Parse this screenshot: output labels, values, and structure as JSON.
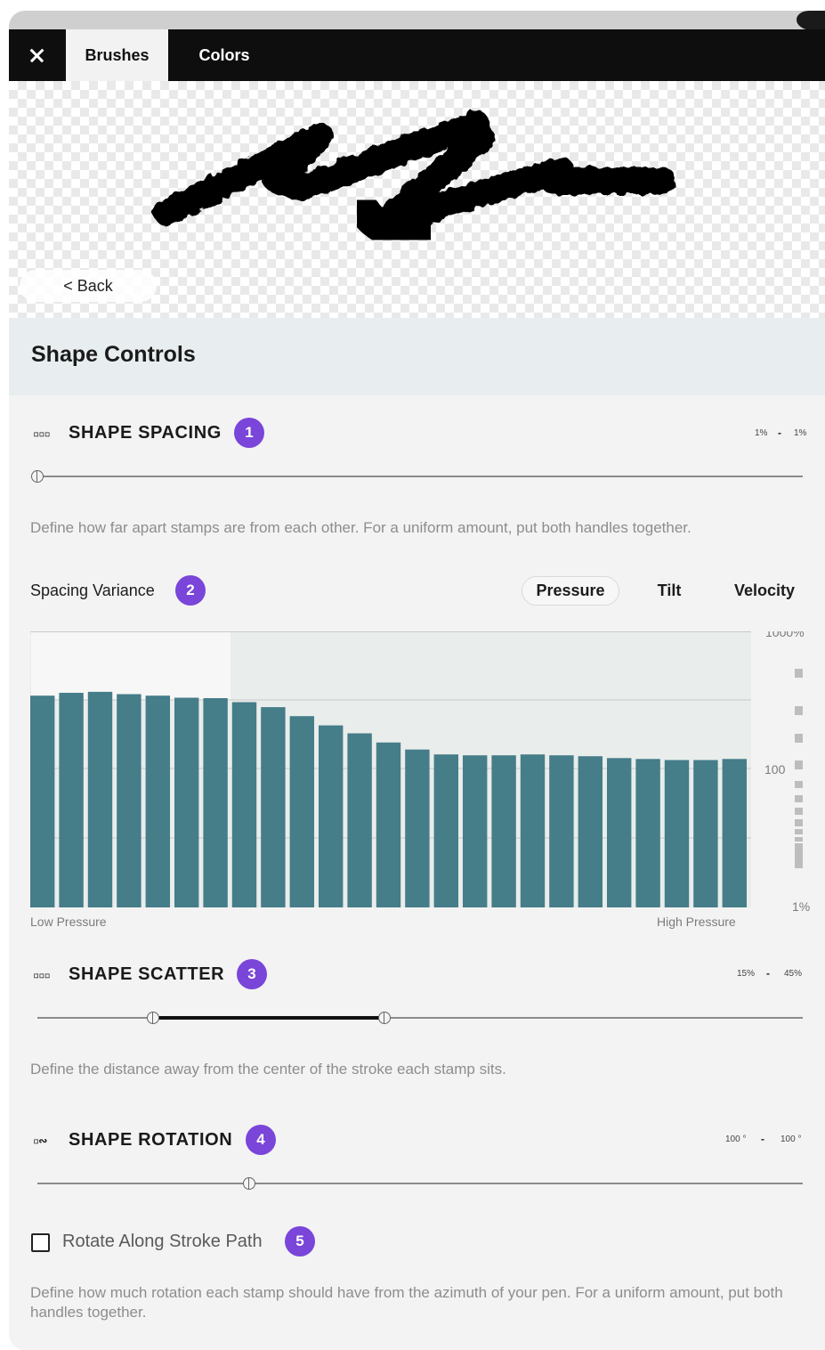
{
  "header": {
    "close_icon": "close-icon",
    "tabs": [
      {
        "label": "Brushes",
        "active": true
      },
      {
        "label": "Colors",
        "active": false
      }
    ]
  },
  "preview": {
    "back_label": "< Back"
  },
  "section": {
    "title": "Shape Controls"
  },
  "shape_spacing": {
    "icon": "spacing-icon",
    "icon_glyph": "▫▫▫",
    "title": "SHAPE SPACING",
    "badge": "1",
    "range_min": "1%",
    "range_sep": "-",
    "range_max": "1%",
    "slider": {
      "low": 0.0,
      "high": 0.0
    },
    "description": "Define how far apart stamps are from each other. For a uniform amount, put both handles together."
  },
  "spacing_variance": {
    "label": "Spacing Variance",
    "badge": "2",
    "modes": [
      "Pressure",
      "Tilt",
      "Velocity"
    ],
    "selected_mode": "Pressure"
  },
  "chart_data": {
    "type": "bar",
    "xlabel_left": "Low Pressure",
    "xlabel_right": "High Pressure",
    "y_ticks": [
      "1000%",
      "100",
      "1%"
    ],
    "y_scale": "log",
    "ylim": [
      1,
      1000
    ],
    "bar_color": "#457d89",
    "values": [
      200,
      215,
      220,
      208,
      200,
      190,
      188,
      170,
      150,
      120,
      95,
      78,
      62,
      52,
      46,
      45,
      45,
      46,
      45,
      44,
      42,
      41,
      40,
      40,
      41
    ]
  },
  "shape_scatter": {
    "icon": "scatter-icon",
    "icon_glyph": "▫▫▫",
    "title": "SHAPE SCATTER",
    "badge": "3",
    "range_min": "15%",
    "range_sep": "-",
    "range_max": "45%",
    "slider": {
      "low": 0.15,
      "high": 0.45
    },
    "description": "Define the distance away from the center of the stroke each stamp sits."
  },
  "shape_rotation": {
    "icon": "rotation-icon",
    "icon_glyph": "▫∾",
    "title": "SHAPE ROTATION",
    "badge": "4",
    "range_min": "100 °",
    "range_sep": "-",
    "range_max": "100 °",
    "slider": {
      "low": 0.28,
      "high": 0.28
    },
    "checkbox_label": "Rotate Along Stroke Path",
    "checkbox_checked": false,
    "checkbox_badge": "5",
    "description": "Define how much rotation each stamp should have from the azimuth of your pen. For a uniform amount, put both handles together."
  },
  "colors": {
    "accent": "#7a45d9",
    "bar": "#457d89",
    "header": "#0e0e0e"
  }
}
